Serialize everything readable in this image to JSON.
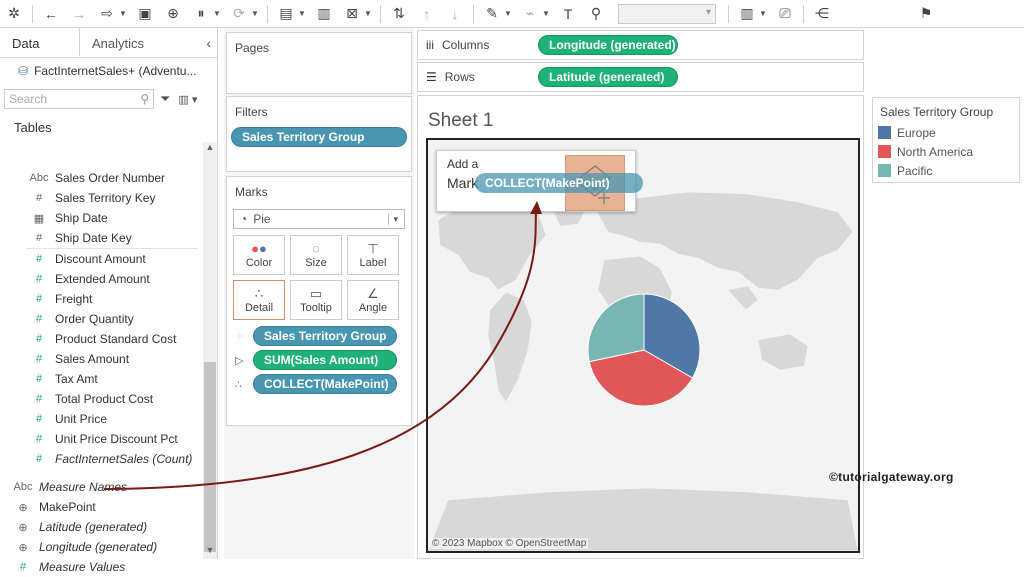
{
  "toolbar": {
    "icons": [
      "tableau-logo-icon",
      "back-icon",
      "forward-icon",
      "connect-icon",
      "save-icon",
      "new-datasource-icon",
      "pause-updates-icon",
      "refresh-icon",
      "new-sheet-icon",
      "duplicate-icon",
      "clear-icon",
      "swap-icon",
      "sort-asc-icon",
      "sort-desc-icon",
      "highlight-icon",
      "attach-icon",
      "label-icon",
      "pin-icon",
      "show-me-icon",
      "presentation-icon",
      "share-icon",
      "connect-pin-icon"
    ]
  },
  "data_pane": {
    "tab_data": "Data",
    "tab_analytics": "Analytics",
    "datasource": "FactInternetSales+ (Adventu...",
    "search_placeholder": "Search",
    "tables_heading": "Tables",
    "fields": [
      {
        "icon": "Abc",
        "label": "Sales Order Number",
        "type": "dim"
      },
      {
        "icon": "#",
        "label": "Sales Territory Key",
        "type": "dim"
      },
      {
        "icon": "▦",
        "label": "Ship Date",
        "type": "dim"
      },
      {
        "icon": "#",
        "label": "Ship Date Key",
        "type": "dim"
      },
      {
        "icon": "#",
        "label": "Discount Amount",
        "type": "meas"
      },
      {
        "icon": "#",
        "label": "Extended Amount",
        "type": "meas"
      },
      {
        "icon": "#",
        "label": "Freight",
        "type": "meas"
      },
      {
        "icon": "#",
        "label": "Order Quantity",
        "type": "meas"
      },
      {
        "icon": "#",
        "label": "Product Standard Cost",
        "type": "meas"
      },
      {
        "icon": "#",
        "label": "Sales Amount",
        "type": "meas"
      },
      {
        "icon": "#",
        "label": "Tax Amt",
        "type": "meas"
      },
      {
        "icon": "#",
        "label": "Total Product Cost",
        "type": "meas"
      },
      {
        "icon": "#",
        "label": "Unit Price",
        "type": "meas"
      },
      {
        "icon": "#",
        "label": "Unit Price Discount Pct",
        "type": "meas"
      },
      {
        "icon": "#",
        "label": "FactInternetSales (Count)",
        "type": "meas",
        "italic": true
      }
    ],
    "extra_fields": [
      {
        "icon": "Abc",
        "label": "Measure Names",
        "italic": true
      },
      {
        "icon": "⊕",
        "label": "MakePoint",
        "italic": false
      },
      {
        "icon": "⊕",
        "label": "Latitude (generated)",
        "italic": true
      },
      {
        "icon": "⊕",
        "label": "Longitude (generated)",
        "italic": true
      },
      {
        "icon": "#",
        "label": "Measure Values",
        "italic": true
      }
    ]
  },
  "cards": {
    "pages": "Pages",
    "filters": "Filters",
    "filter_pill": "Sales Territory Group",
    "marks": "Marks",
    "mark_type": "Pie",
    "mark_buttons": [
      {
        "label": "Color",
        "icon": "color-icon"
      },
      {
        "label": "Size",
        "icon": "size-icon"
      },
      {
        "label": "Label",
        "icon": "label-icon"
      },
      {
        "label": "Detail",
        "icon": "detail-icon"
      },
      {
        "label": "Tooltip",
        "icon": "tooltip-icon"
      },
      {
        "label": "Angle",
        "icon": "angle-icon"
      }
    ],
    "mark_pills": [
      {
        "label": "Sales Territory Group",
        "color": "#4996b2"
      },
      {
        "label": "SUM(Sales Amount)",
        "color": "#1fb278"
      },
      {
        "label": "COLLECT(MakePoint)",
        "color": "#4996b2"
      }
    ]
  },
  "shelves": {
    "columns_label": "Columns",
    "columns_pill": "Longitude (generated)",
    "rows_label": "Rows",
    "rows_pill": "Latitude (generated)"
  },
  "sheet": {
    "title": "Sheet 1",
    "drag_add_line1": "Add a",
    "drag_add_line2": "Mark",
    "drag_pill": "COLLECT(MakePoint)",
    "copyright": "© 2023 Mapbox © OpenStreetMap",
    "watermark": "©tutorialgateway.org"
  },
  "legend": {
    "title": "Sales Territory Group",
    "items": [
      {
        "label": "Europe",
        "color": "#4e79a7"
      },
      {
        "label": "North America",
        "color": "#e15759"
      },
      {
        "label": "Pacific",
        "color": "#76b7b2"
      }
    ]
  }
}
